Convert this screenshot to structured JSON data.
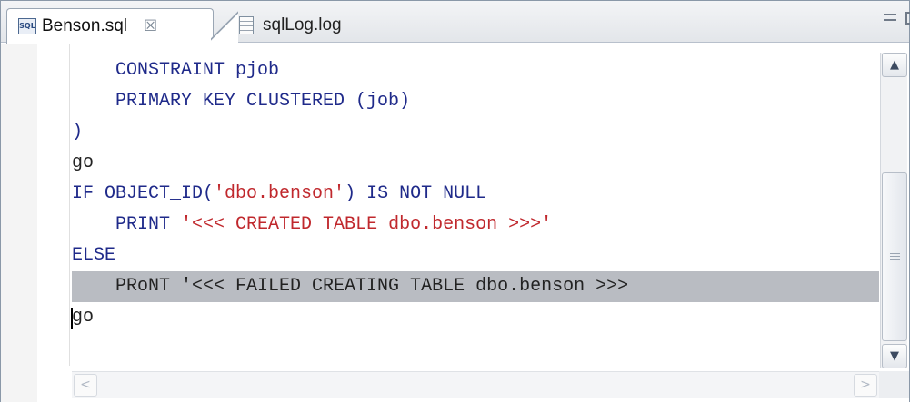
{
  "tabs": [
    {
      "label": "Benson.sql",
      "icon": "sql-file-icon",
      "active": true,
      "close_glyph": "☒"
    },
    {
      "label": "sqlLog.log",
      "icon": "log-file-icon",
      "active": false
    }
  ],
  "editor": {
    "lines": [
      [
        {
          "t": "    CONSTRAINT pjob",
          "c": "kw"
        }
      ],
      [
        {
          "t": "    PRIMARY KEY CLUSTERED (job)",
          "c": "kw"
        }
      ],
      [
        {
          "t": ")",
          "c": "kw"
        }
      ],
      [
        {
          "t": "go",
          "c": "plain"
        }
      ],
      [
        {
          "t": "IF OBJECT_ID(",
          "c": "kw"
        },
        {
          "t": "'dbo.benson'",
          "c": "str"
        },
        {
          "t": ") IS NOT NULL",
          "c": "kw"
        }
      ],
      [
        {
          "t": "    PRINT ",
          "c": "kw"
        },
        {
          "t": "'<<< CREATED TABLE dbo.benson >>>'",
          "c": "str"
        }
      ],
      [
        {
          "t": "ELSE",
          "c": "kw"
        }
      ],
      [
        {
          "t": "    PRoNT '<<< FAILED CREATING TABLE dbo.benson >>>",
          "c": "plain"
        }
      ],
      [
        {
          "t": "go",
          "c": "plain"
        }
      ]
    ],
    "highlighted_line": 7,
    "caret_line": 8
  },
  "scrollbar": {
    "up_glyph": "▲",
    "down_glyph": "▼",
    "left_glyph": "<",
    "right_glyph": ">"
  },
  "colors": {
    "keyword": "#1f2a8a",
    "string": "#c0282d",
    "highlight": "#b9bcc2"
  }
}
